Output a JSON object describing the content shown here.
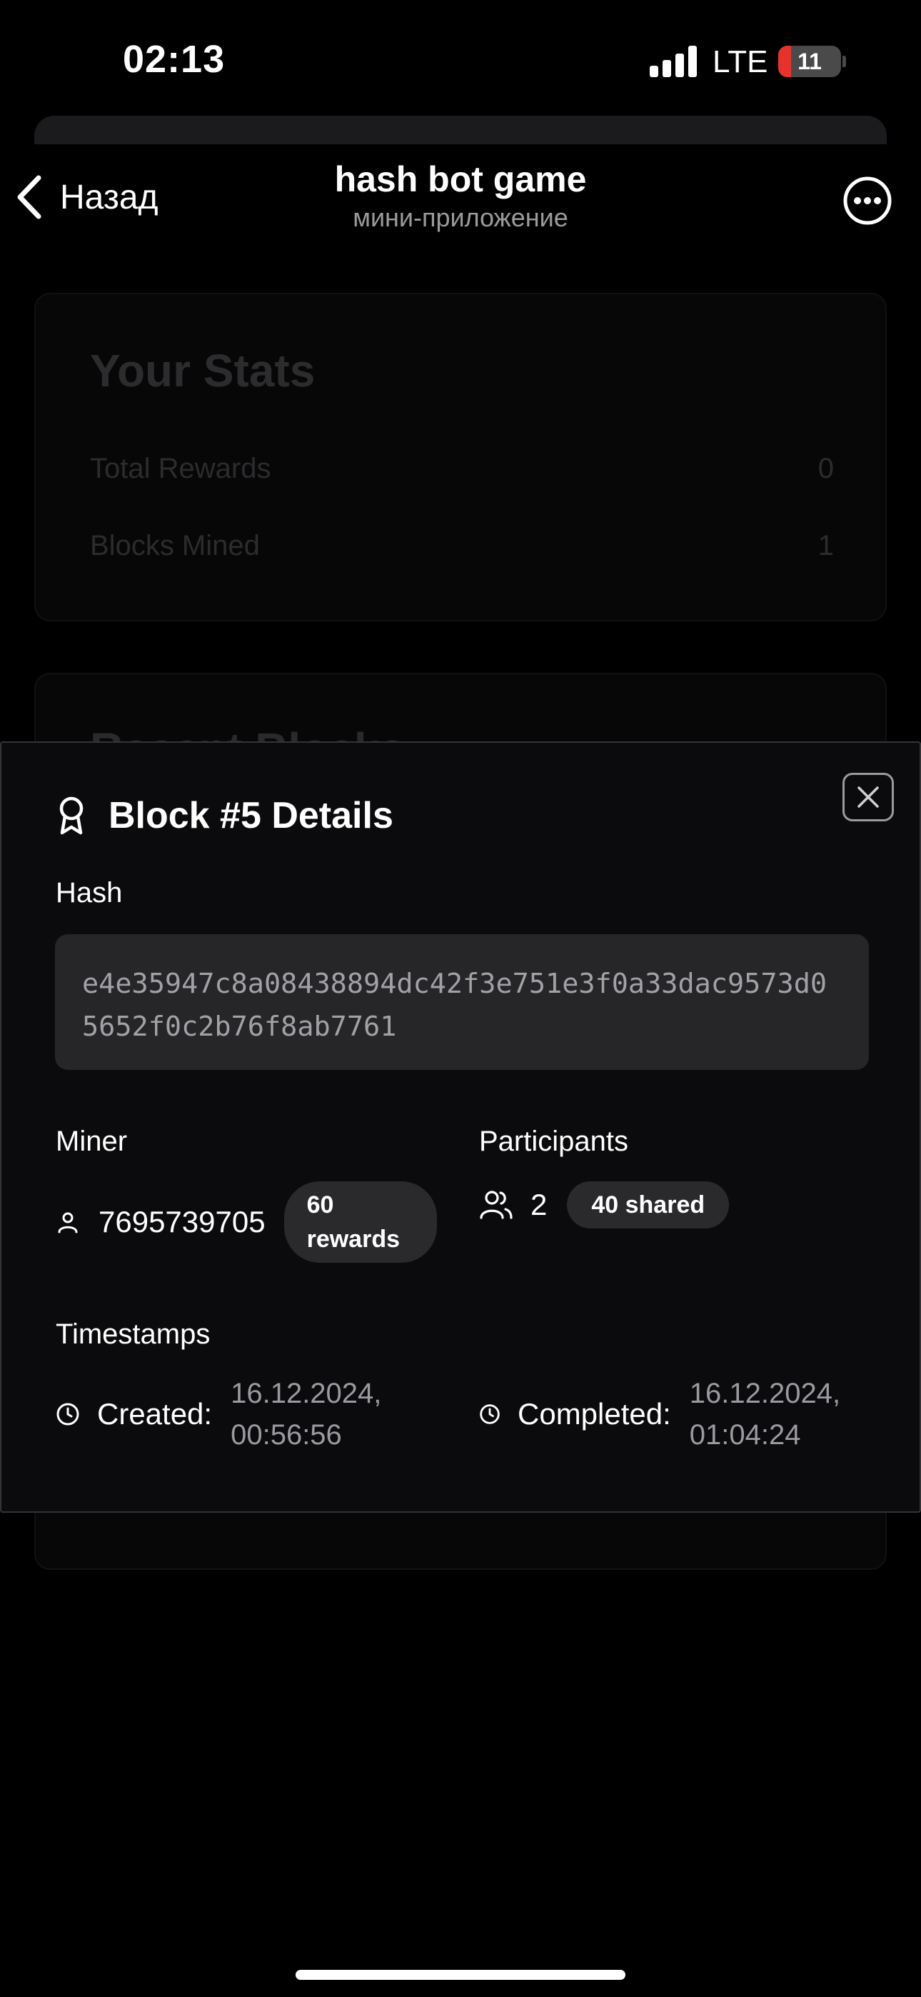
{
  "status_bar": {
    "time": "02:13",
    "network": "LTE",
    "battery_level": "11"
  },
  "header": {
    "back_label": "Назад",
    "title": "hash bot game",
    "subtitle": "мини-приложение"
  },
  "stats": {
    "title": "Your Stats",
    "rows": [
      {
        "label": "Total Rewards",
        "value": "0"
      },
      {
        "label": "Blocks Mined",
        "value": "1"
      }
    ]
  },
  "recent": {
    "title": "Recent Blocks"
  },
  "modal": {
    "title": "Block #5 Details",
    "hash_label": "Hash",
    "hash_value": "e4e35947c8a08438894dc42f3e751e3f0a33dac9573d05652f0c2b76f8ab7761",
    "miner_label": "Miner",
    "miner_id": "7695739705",
    "miner_rewards_line1": "60",
    "miner_rewards_line2": "rewards",
    "participants_label": "Participants",
    "participants_count": "2",
    "participants_shared": "40 shared",
    "timestamps_label": "Timestamps",
    "created_label": "Created:",
    "created_date": "16.12.2024,",
    "created_time": "00:56:56",
    "completed_label": "Completed:",
    "completed_date": "16.12.2024,",
    "completed_time": "01:04:24"
  },
  "icons": {
    "back": "chevron-left-icon",
    "more": "more-horizontal-icon",
    "award": "award-icon",
    "close": "close-icon",
    "user": "user-icon",
    "users": "users-icon",
    "clock": "clock-icon"
  },
  "colors": {
    "background": "#000000",
    "modal": "#0b0b0d",
    "hash_box": "#262629",
    "pill": "#2a2a2d",
    "battery_low": "#e5322d"
  }
}
